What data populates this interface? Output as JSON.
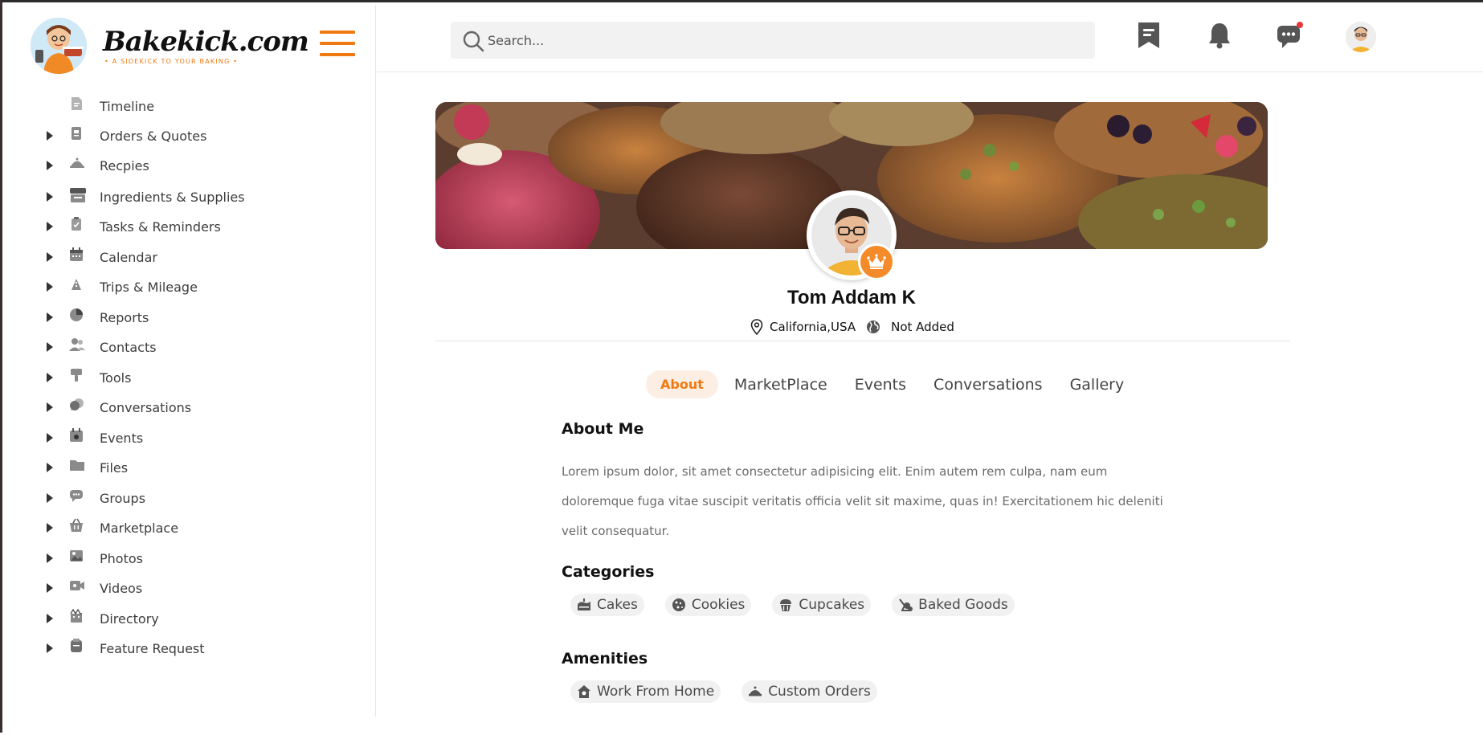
{
  "brand": {
    "name": "Bakekick.com",
    "tagline": "• A SIDEKICK TO YOUR BAKING •",
    "accent": "#f07a12"
  },
  "sidebar": {
    "items": [
      {
        "label": "Timeline",
        "icon": "timeline-icon",
        "expandable": false
      },
      {
        "label": "Orders & Quotes",
        "icon": "orders-icon",
        "expandable": true
      },
      {
        "label": "Recpies",
        "icon": "recipes-cloche-icon",
        "expandable": true
      },
      {
        "label": "Ingredients & Supplies",
        "icon": "ingredients-icon",
        "expandable": true
      },
      {
        "label": "Tasks & Reminders",
        "icon": "clipboard-check-icon",
        "expandable": true
      },
      {
        "label": "Calendar",
        "icon": "calendar-icon",
        "expandable": true
      },
      {
        "label": "Trips & Mileage",
        "icon": "trips-icon",
        "expandable": true
      },
      {
        "label": "Reports",
        "icon": "reports-icon",
        "expandable": true
      },
      {
        "label": "Contacts",
        "icon": "contacts-icon",
        "expandable": true
      },
      {
        "label": "Tools",
        "icon": "tools-icon",
        "expandable": true
      },
      {
        "label": "Conversations",
        "icon": "chat-bubbles-icon",
        "expandable": true
      },
      {
        "label": "Events",
        "icon": "event-calendar-icon",
        "expandable": true
      },
      {
        "label": "Files",
        "icon": "folder-icon",
        "expandable": true
      },
      {
        "label": "Groups",
        "icon": "group-chat-icon",
        "expandable": true
      },
      {
        "label": "Marketplace",
        "icon": "basket-icon",
        "expandable": true
      },
      {
        "label": "Photos",
        "icon": "image-icon",
        "expandable": true
      },
      {
        "label": "Videos",
        "icon": "video-icon",
        "expandable": true
      },
      {
        "label": "Directory",
        "icon": "directory-icon",
        "expandable": true
      },
      {
        "label": "Feature Request",
        "icon": "feature-request-icon",
        "expandable": true
      }
    ]
  },
  "header": {
    "search": {
      "placeholder": "Search...",
      "value": ""
    },
    "icons": [
      "notes-icon",
      "bell-icon",
      "messages-icon",
      "user-avatar"
    ],
    "notification_dot_color": "#e53935"
  },
  "profile": {
    "name": "Tom Addam K",
    "location": "California,USA",
    "website": "Not Added",
    "badge_icon": "crown-icon",
    "badge_color": "#f58a2a"
  },
  "tabs": [
    {
      "label": "About",
      "active": true
    },
    {
      "label": "MarketPlace",
      "active": false
    },
    {
      "label": "Events",
      "active": false
    },
    {
      "label": "Conversations",
      "active": false
    },
    {
      "label": "Gallery",
      "active": false
    }
  ],
  "about": {
    "title": "About Me",
    "body": "Lorem ipsum dolor, sit amet consectetur adipisicing elit. Enim autem rem culpa, nam eum doloremque fuga vitae suscipit veritatis officia velit sit maxime, quas in! Exercitationem hic deleniti velit consequatur."
  },
  "categories": {
    "title": "Categories",
    "items": [
      {
        "label": "Cakes",
        "icon": "cake-icon"
      },
      {
        "label": "Cookies",
        "icon": "cookie-icon"
      },
      {
        "label": "Cupcakes",
        "icon": "cupcake-icon"
      },
      {
        "label": "Baked Goods",
        "icon": "baked-goods-icon"
      }
    ]
  },
  "amenities": {
    "title": "Amenities",
    "items": [
      {
        "label": "Work From Home",
        "icon": "home-icon"
      },
      {
        "label": "Custom Orders",
        "icon": "cloche-icon"
      }
    ]
  }
}
